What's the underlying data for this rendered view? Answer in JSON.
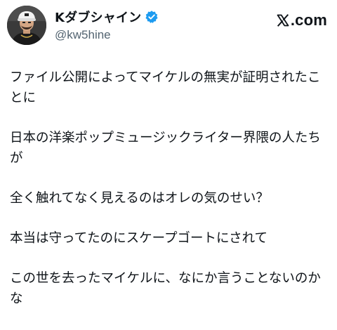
{
  "author": {
    "display_name": "Kダブシャイン",
    "handle": "@kw5hine",
    "verified": true,
    "verified_color": "#1d9bf0",
    "avatar_icon": "user-avatar-photo"
  },
  "brand": {
    "text": ".com",
    "icon": "x-logo-icon"
  },
  "post": {
    "paragraphs": [
      "ファイル公開によってマイケルの無実が証明されたことに",
      "日本の洋楽ポップミュージックライター界隈の人たちが",
      "全く触れてなく見えるのはオレの気のせい？",
      "本当は守ってたのにスケープゴートにされて",
      "この世を去ったマイケルに、なにか言うことないのかな"
    ]
  },
  "colors": {
    "text": "#0f1419",
    "secondary_text": "#536471",
    "background": "#ffffff"
  }
}
